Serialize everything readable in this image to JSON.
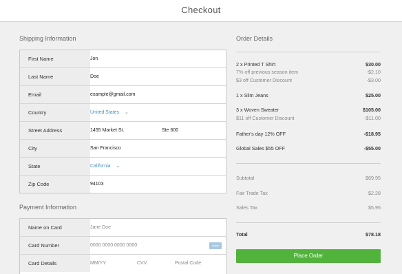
{
  "header": {
    "title": "Checkout"
  },
  "shipping": {
    "title": "Shipping Information",
    "rows": [
      {
        "label": "First Name",
        "value": "Jon"
      },
      {
        "label": "Last Name",
        "value": "Doe"
      },
      {
        "label": "Email",
        "value": "example@gmail.com"
      },
      {
        "label": "Country",
        "value": "United States"
      },
      {
        "label": "Street Address",
        "value": "1455 Market St.",
        "value2": "Ste 600"
      },
      {
        "label": "City",
        "value": "San Francisco"
      },
      {
        "label": "State",
        "value": "California"
      },
      {
        "label": "Zip Code",
        "value": "94103"
      }
    ]
  },
  "payment": {
    "title": "Payment Information",
    "rows": [
      {
        "label": "Name on Card",
        "placeholder": "Jane Doe"
      },
      {
        "label": "Card Number",
        "placeholder": "0000 0000 0000 0000"
      },
      {
        "label": "Card Details",
        "mm": "MM/YY",
        "cvv": "CVV",
        "postal": "Postal Code"
      }
    ]
  },
  "order": {
    "title": "Order Details",
    "items": [
      {
        "name": "2 x Printed T Shirt",
        "price": "$30.00"
      },
      {
        "name": "7% off previous season item",
        "price": "-$2.10"
      },
      {
        "name": "$3 off Customer Discount",
        "price": "-$3.00"
      },
      {
        "name": "1 x Slim Jeans",
        "price": "$25.00"
      },
      {
        "name": "3 x Woven Sweater",
        "price": "$105.00"
      },
      {
        "name": "$11 off Customer Discount",
        "price": "-$11.00"
      },
      {
        "name": "Father's day 12% OFF",
        "price": "-$18.95"
      },
      {
        "name": "Global Sales $55 OFF",
        "price": "-$55.00"
      }
    ],
    "subtotal_label": "Subtotal",
    "subtotal": "$69.95",
    "tax1_label": "Fair Trade Tax",
    "tax1": "$2.28",
    "tax2_label": "Sales Tax",
    "tax2": "$5.95",
    "total_label": "Total",
    "total": "$78.18",
    "button": "Place Order"
  }
}
